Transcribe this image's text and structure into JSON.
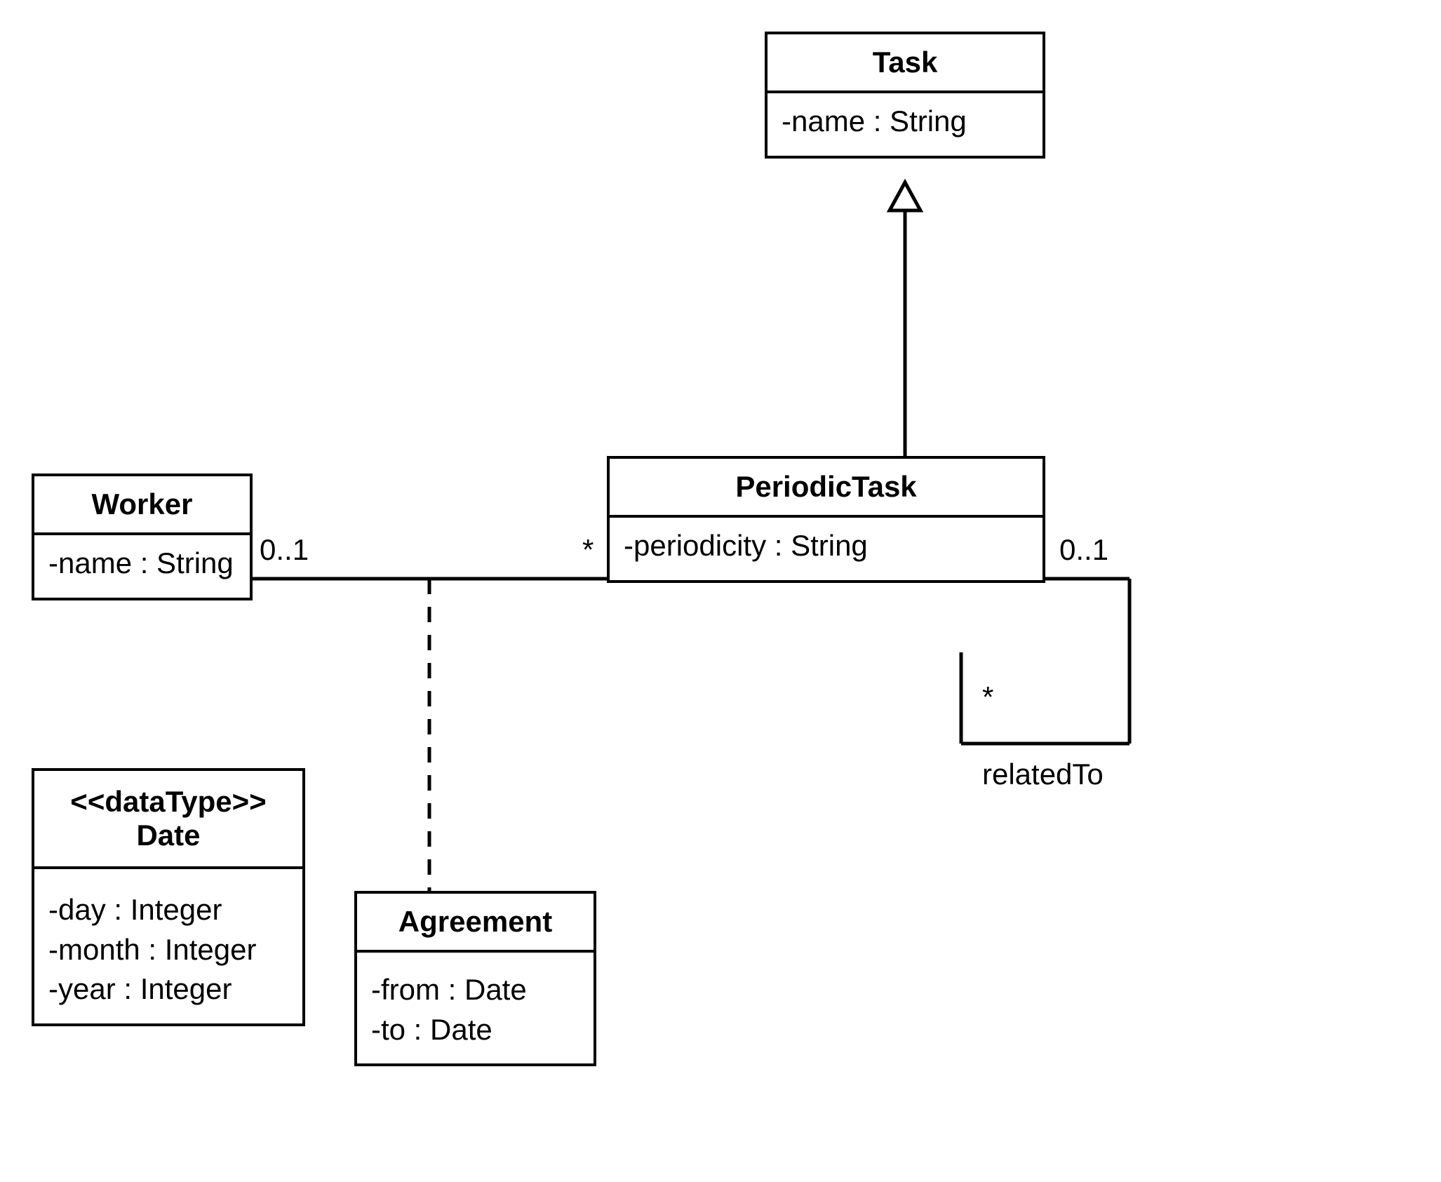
{
  "classes": {
    "task": {
      "name": "Task",
      "attributes": [
        "-name : String"
      ]
    },
    "worker": {
      "name": "Worker",
      "attributes": [
        "-name : String"
      ]
    },
    "periodicTask": {
      "name": "PeriodicTask",
      "attributes": [
        "-periodicity : String"
      ]
    },
    "date": {
      "stereotype": "<<dataType>>",
      "name": "Date",
      "attributes": [
        "-day : Integer",
        "-month : Integer",
        "-year : Integer"
      ]
    },
    "agreement": {
      "name": "Agreement",
      "attributes": [
        "-from : Date",
        "-to : Date"
      ]
    }
  },
  "relations": {
    "workerPeriodic": {
      "leftMult": "0..1",
      "rightMult": "*"
    },
    "relatedTo": {
      "topMult": "0..1",
      "bottomMult": "*",
      "label": "relatedTo"
    },
    "taskGeneralization": {
      "type": "generalization"
    },
    "agreementAssoc": {
      "type": "associationClass"
    }
  }
}
